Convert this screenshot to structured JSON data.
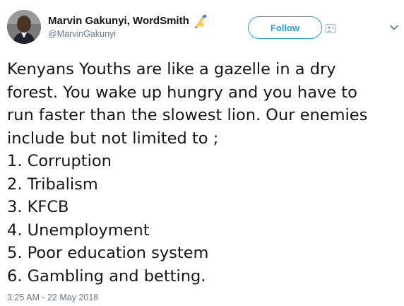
{
  "author": {
    "display_name": "Marvin Gakunyi, WordSmith",
    "handle": "@MarvinGakunyi",
    "name_badge_icon": "writing-hand-icon"
  },
  "actions": {
    "follow_label": "Follow"
  },
  "tweet": {
    "intro_lines": [
      "Kenyans Youths are like a gazelle in a dry",
      "forest. You wake up hungry and you have to",
      "run faster than the slowest lion. Our enemies",
      "include but not limited to ;"
    ],
    "list": [
      "1. Corruption",
      "2. Tribalism",
      "3. KFCB",
      "4. Unemployment",
      "5. Poor education system",
      "6. Gambling and betting."
    ],
    "timestamp": "3:25 AM - 22 May 2018"
  },
  "colors": {
    "accent": "#1da1f2",
    "text": "#14171a",
    "secondary_text": "#657786"
  }
}
